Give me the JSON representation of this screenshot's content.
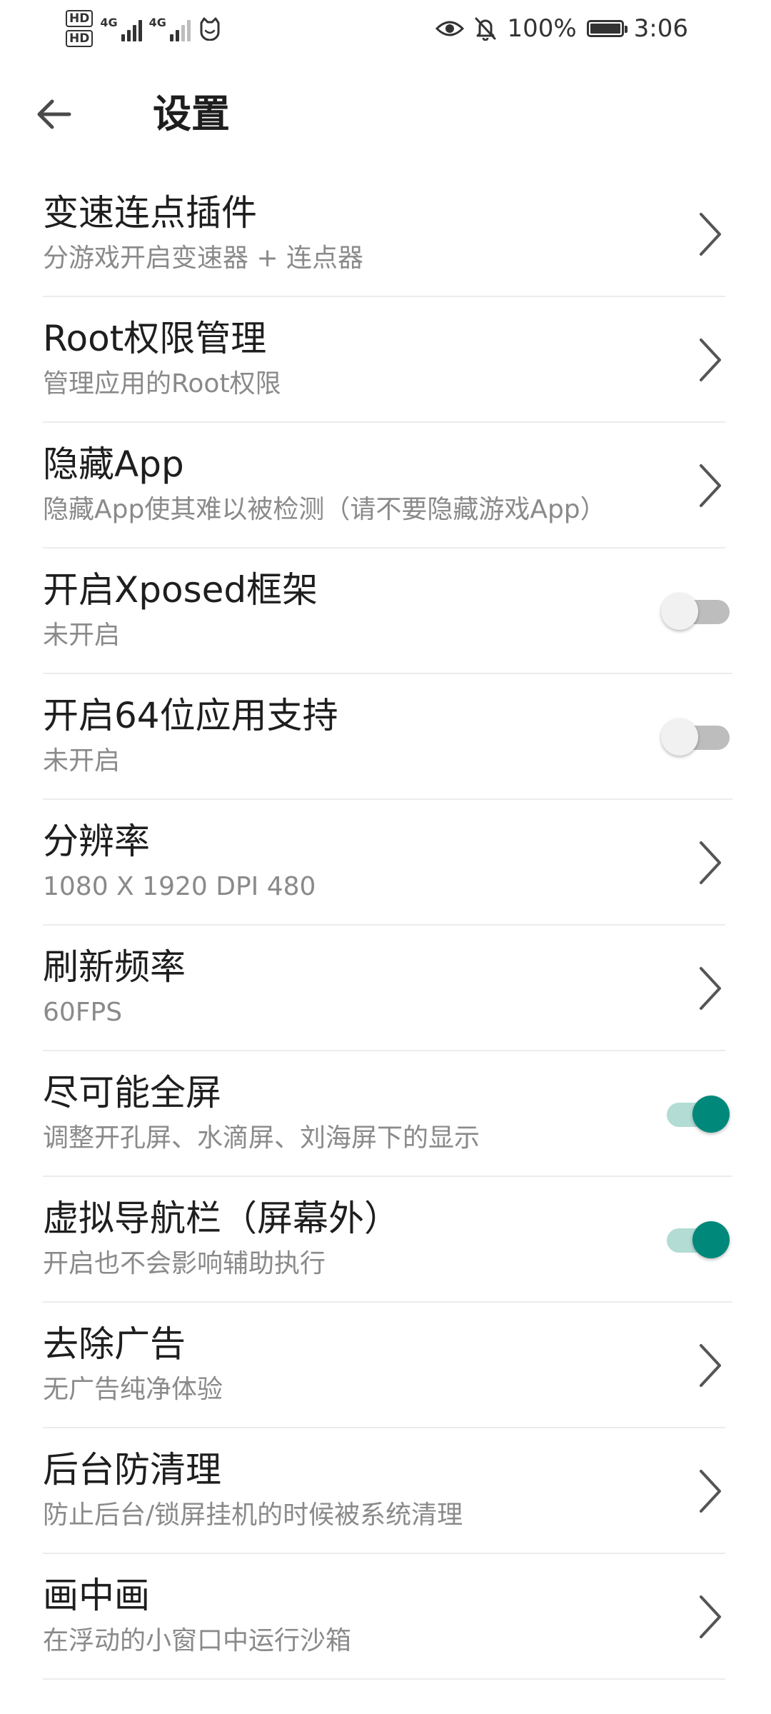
{
  "status_bar": {
    "hd1": "HD",
    "hd2": "HD",
    "net1": "4G",
    "net2": "4G",
    "battery_percent": "100%",
    "time": "3:06"
  },
  "header": {
    "title": "设置"
  },
  "settings": [
    {
      "title": "变速连点插件",
      "subtitle": "分游戏开启变速器 + 连点器",
      "control": "chevron"
    },
    {
      "title": "Root权限管理",
      "subtitle": "管理应用的Root权限",
      "control": "chevron"
    },
    {
      "title": "隐藏App",
      "subtitle": "隐藏App使其难以被检测（请不要隐藏游戏App）",
      "control": "chevron"
    },
    {
      "title": "开启Xposed框架",
      "subtitle": "未开启",
      "control": "toggle",
      "on": false
    },
    {
      "title": "开启64位应用支持",
      "subtitle": "未开启",
      "control": "toggle",
      "on": false
    },
    {
      "title": "分辨率",
      "subtitle": "1080 X 1920 DPI 480",
      "control": "chevron"
    },
    {
      "title": "刷新频率",
      "subtitle": "60FPS",
      "control": "chevron"
    },
    {
      "title": "尽可能全屏",
      "subtitle": "调整开孔屏、水滴屏、刘海屏下的显示",
      "control": "toggle",
      "on": true
    },
    {
      "title": "虚拟导航栏（屏幕外）",
      "subtitle": "开启也不会影响辅助执行",
      "control": "toggle",
      "on": true
    },
    {
      "title": "去除广告",
      "subtitle": "无广告纯净体验",
      "control": "chevron"
    },
    {
      "title": "后台防清理",
      "subtitle": "防止后台/锁屏挂机的时候被系统清理",
      "control": "chevron"
    },
    {
      "title": "画中画",
      "subtitle": "在浮动的小窗口中运行沙箱",
      "control": "chevron"
    }
  ],
  "colors": {
    "accent": "#00897b",
    "track_on": "#b2dcd4",
    "track_off": "#bdbdbd",
    "subtitle": "#8a8a8a"
  },
  "icons": {
    "back": "arrow-left-icon",
    "chevron": "chevron-right-icon",
    "eye": "eye-icon",
    "mute": "bell-off-icon",
    "battery": "battery-icon"
  }
}
